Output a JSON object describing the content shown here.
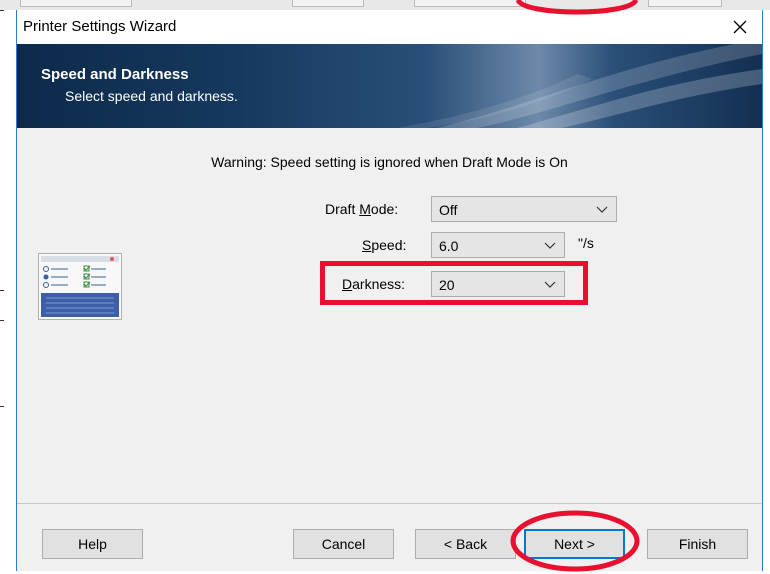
{
  "window": {
    "title": "Printer Settings Wizard",
    "close_glyph": "✕"
  },
  "banner": {
    "title": "Speed and Darkness",
    "subtitle": "Select speed and darkness."
  },
  "warning": "Warning: Speed setting is ignored when Draft Mode is On",
  "fields": {
    "draft_mode": {
      "label_pre": "Draft ",
      "label_ul": "M",
      "label_post": "ode:",
      "value": "Off"
    },
    "speed": {
      "label_pre": "",
      "label_ul": "S",
      "label_post": "peed:",
      "value": "6.0",
      "unit": "\"/s"
    },
    "darkness": {
      "label_pre": "",
      "label_ul": "D",
      "label_post": "arkness:",
      "value": "20"
    }
  },
  "buttons": {
    "help": "Help",
    "cancel": "Cancel",
    "back": "< Back",
    "next": "Next >",
    "finish": "Finish"
  },
  "annotations": {
    "highlight_color": "#e8102e"
  }
}
